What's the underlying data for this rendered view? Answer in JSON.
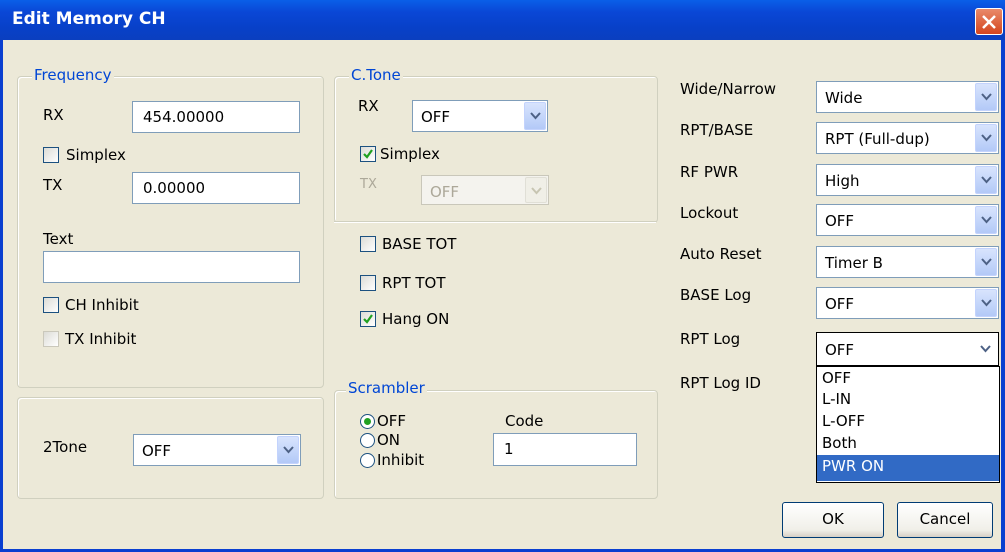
{
  "window": {
    "title": "Edit Memory CH"
  },
  "frequency": {
    "legend": "Frequency",
    "rx_label": "RX",
    "rx_value": "454.00000",
    "simplex_label": "Simplex",
    "tx_label": "TX",
    "tx_value": "0.00000",
    "text_label": "Text",
    "text_value": "",
    "ch_inhibit_label": "CH Inhibit",
    "tx_inhibit_label": "TX Inhibit"
  },
  "ctone": {
    "legend": "C.Tone",
    "rx_label": "RX",
    "rx_value": "OFF",
    "simplex_label": "Simplex",
    "simplex_checked": true,
    "tx_label": "TX",
    "tx_value": "OFF"
  },
  "options": {
    "base_tot_label": "BASE TOT",
    "rpt_tot_label": "RPT TOT",
    "hang_on_label": "Hang ON",
    "hang_on_checked": true
  },
  "twotone": {
    "label": "2Tone",
    "value": "OFF"
  },
  "scrambler": {
    "legend": "Scrambler",
    "off_label": "OFF",
    "on_label": "ON",
    "inhibit_label": "Inhibit",
    "selected": "OFF",
    "code_label": "Code",
    "code_value": "1"
  },
  "settings": {
    "wide_narrow_label": "Wide/Narrow",
    "wide_narrow_value": "Wide",
    "rpt_base_label": "RPT/BASE",
    "rpt_base_value": "RPT (Full-dup)",
    "rf_pwr_label": "RF PWR",
    "rf_pwr_value": "High",
    "lockout_label": "Lockout",
    "lockout_value": "OFF",
    "auto_reset_label": "Auto Reset",
    "auto_reset_value": "Timer B",
    "base_log_label": "BASE Log",
    "base_log_value": "OFF",
    "rpt_log_label": "RPT Log",
    "rpt_log_value": "OFF",
    "rpt_log_id_label": "RPT Log ID"
  },
  "dropdown": {
    "options": [
      "OFF",
      "L-IN",
      "L-OFF",
      "Both",
      "PWR ON"
    ],
    "highlighted": "PWR ON"
  },
  "buttons": {
    "ok_label": "OK",
    "cancel_label": "Cancel"
  },
  "colors": {
    "title_bar": "#0a47d6",
    "dialog_bg": "#ece9d8",
    "legend_text": "#0046d5",
    "highlight": "#316ac5"
  }
}
